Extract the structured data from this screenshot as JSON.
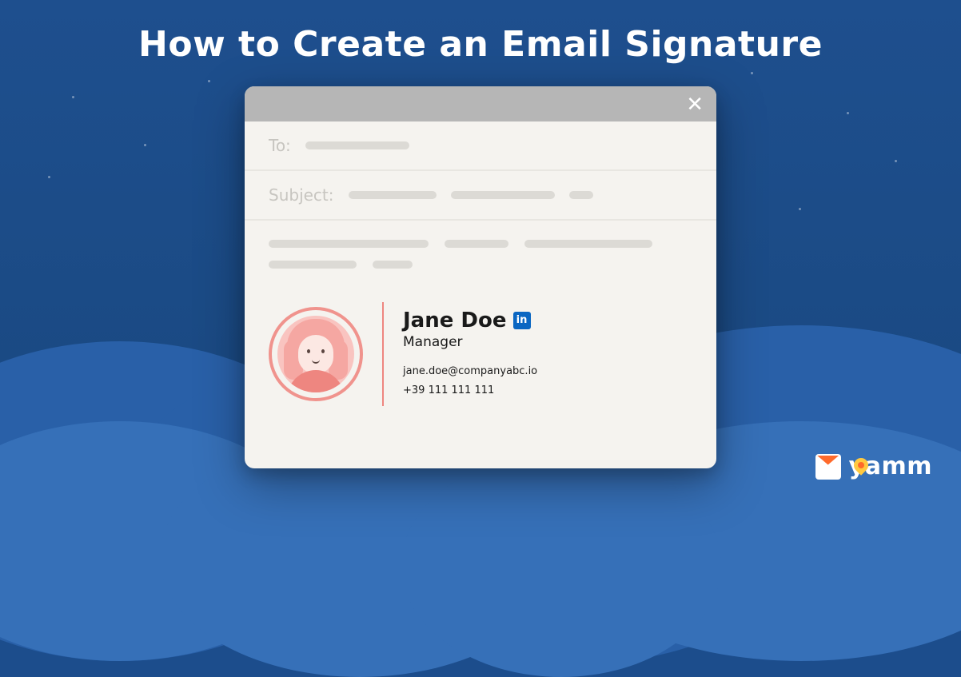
{
  "title": "How to Create an Email Signature",
  "compose": {
    "to_label": "To:",
    "subject_label": "Subject:"
  },
  "signature": {
    "name": "Jane Doe",
    "role": "Manager",
    "email": "jane.doe@companyabc.io",
    "phone": "+39 111 111 111"
  },
  "brand": {
    "name": "yamm"
  }
}
